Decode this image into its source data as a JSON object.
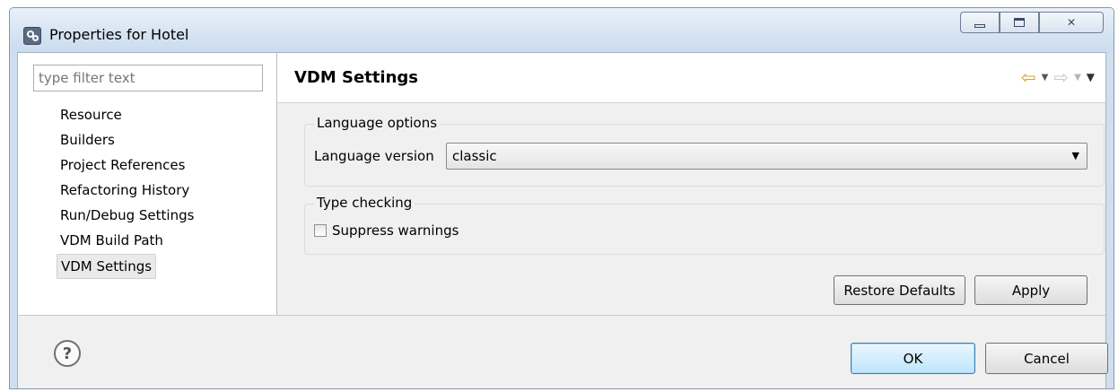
{
  "window": {
    "title": "Properties for Hotel"
  },
  "filter": {
    "placeholder": "type filter text"
  },
  "tree": {
    "items": [
      {
        "label": "Resource"
      },
      {
        "label": "Builders"
      },
      {
        "label": "Project References"
      },
      {
        "label": "Refactoring History"
      },
      {
        "label": "Run/Debug Settings"
      },
      {
        "label": "VDM Build Path"
      },
      {
        "label": "VDM Settings",
        "selected": true
      }
    ]
  },
  "page": {
    "title": "VDM Settings",
    "icons": [
      "back-arrow-icon",
      "back-dropdown-icon",
      "forward-arrow-icon",
      "forward-dropdown-icon",
      "view-menu-icon"
    ]
  },
  "language_options": {
    "legend": "Language options",
    "version_label": "Language version",
    "version_value": "classic"
  },
  "type_checking": {
    "legend": "Type checking",
    "suppress_label": "Suppress warnings",
    "suppress_checked": false
  },
  "buttons": {
    "restore_defaults": "Restore Defaults",
    "apply": "Apply",
    "ok": "OK",
    "cancel": "Cancel"
  },
  "colors": {
    "back_arrow": "#e0a21b",
    "ok_button_border": "#3c7fb1"
  }
}
